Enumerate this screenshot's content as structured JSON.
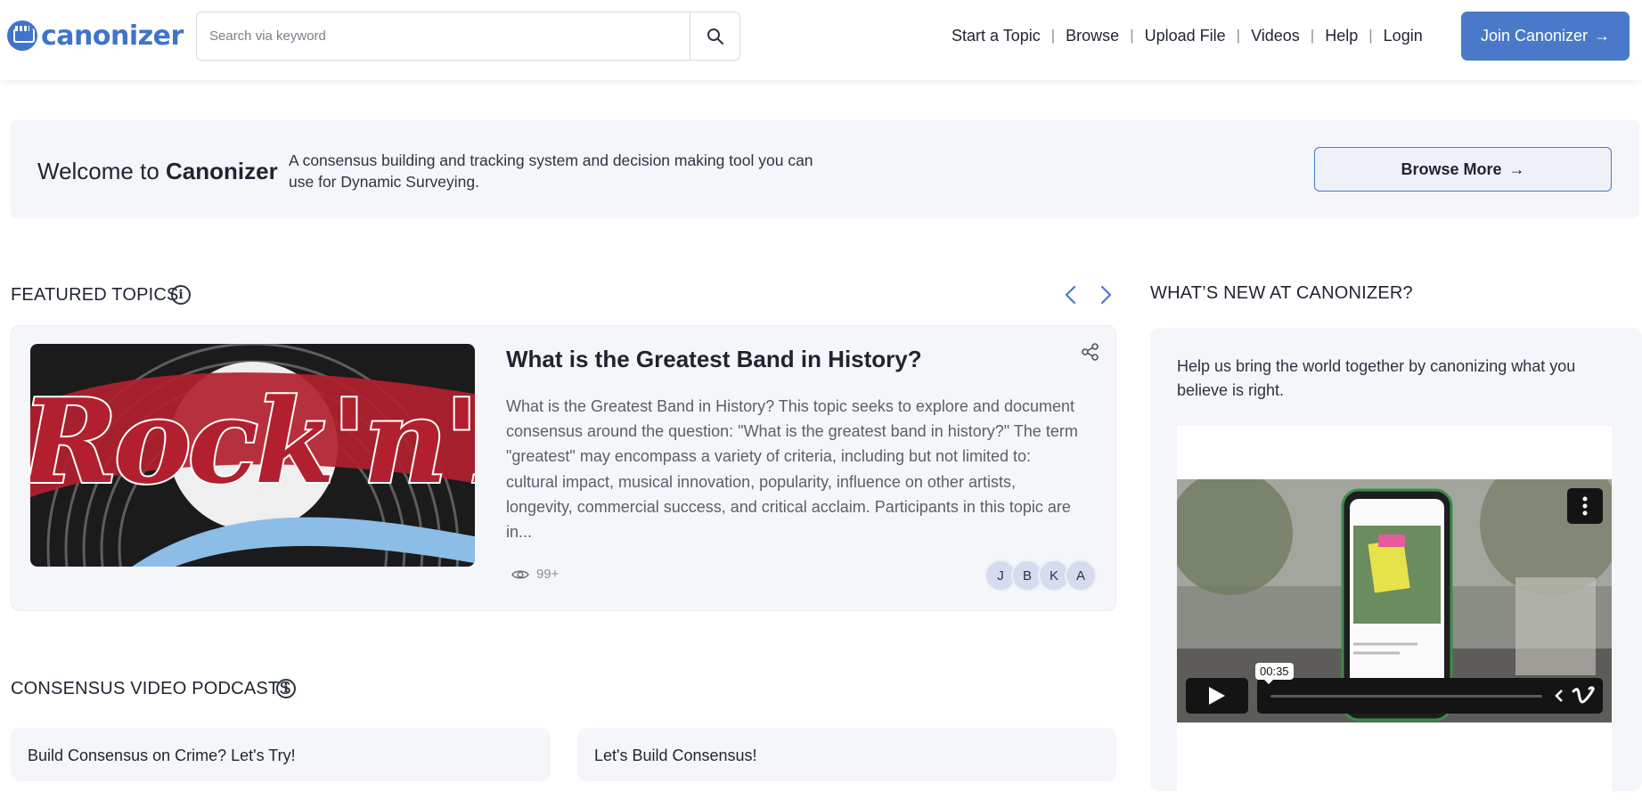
{
  "header": {
    "logo_text": "canonizer",
    "search_placeholder": "Search via keyword",
    "nav": {
      "start_topic": "Start a Topic",
      "browse": "Browse",
      "upload_file": "Upload File",
      "videos": "Videos",
      "help": "Help",
      "login": "Login",
      "separator": "|"
    },
    "join_label": "Join Canonizer",
    "accent_color": "#4a79c9"
  },
  "welcome": {
    "title_prefix": "Welcome to",
    "title_brand": "Canonizer",
    "description": "A consensus building and tracking system and decision making tool you can use for Dynamic Surveying.",
    "browse_more_label": "Browse More"
  },
  "featured": {
    "section_title": "FEATURED TOPICS",
    "topic_title": "What is the Greatest Band in History?",
    "topic_description": "What is the Greatest Band in History? This topic seeks to explore and document consensus around the question: \"What is the greatest band in history?\" The term \"greatest\" may encompass a variety of criteria, including but not limited to: cultural impact, musical innovation, popularity, influence on other artists, longevity, commercial success, and critical acclaim. Participants in this topic are in...",
    "views": "99+",
    "avatars": [
      "J",
      "B",
      "K",
      "A"
    ],
    "image_text": "Rock'n'Roll"
  },
  "whats_new": {
    "section_title": "WHAT’S NEW AT CANONIZER?",
    "text": "Help us bring the world together by canonizing what you believe is right.",
    "video_time": "00:35"
  },
  "podcasts": {
    "section_title": "CONSENSUS VIDEO PODCASTS",
    "items": [
      {
        "title": "Build Consensus on Crime? Let's Try!"
      },
      {
        "title": "Let's Build Consensus!"
      }
    ]
  }
}
